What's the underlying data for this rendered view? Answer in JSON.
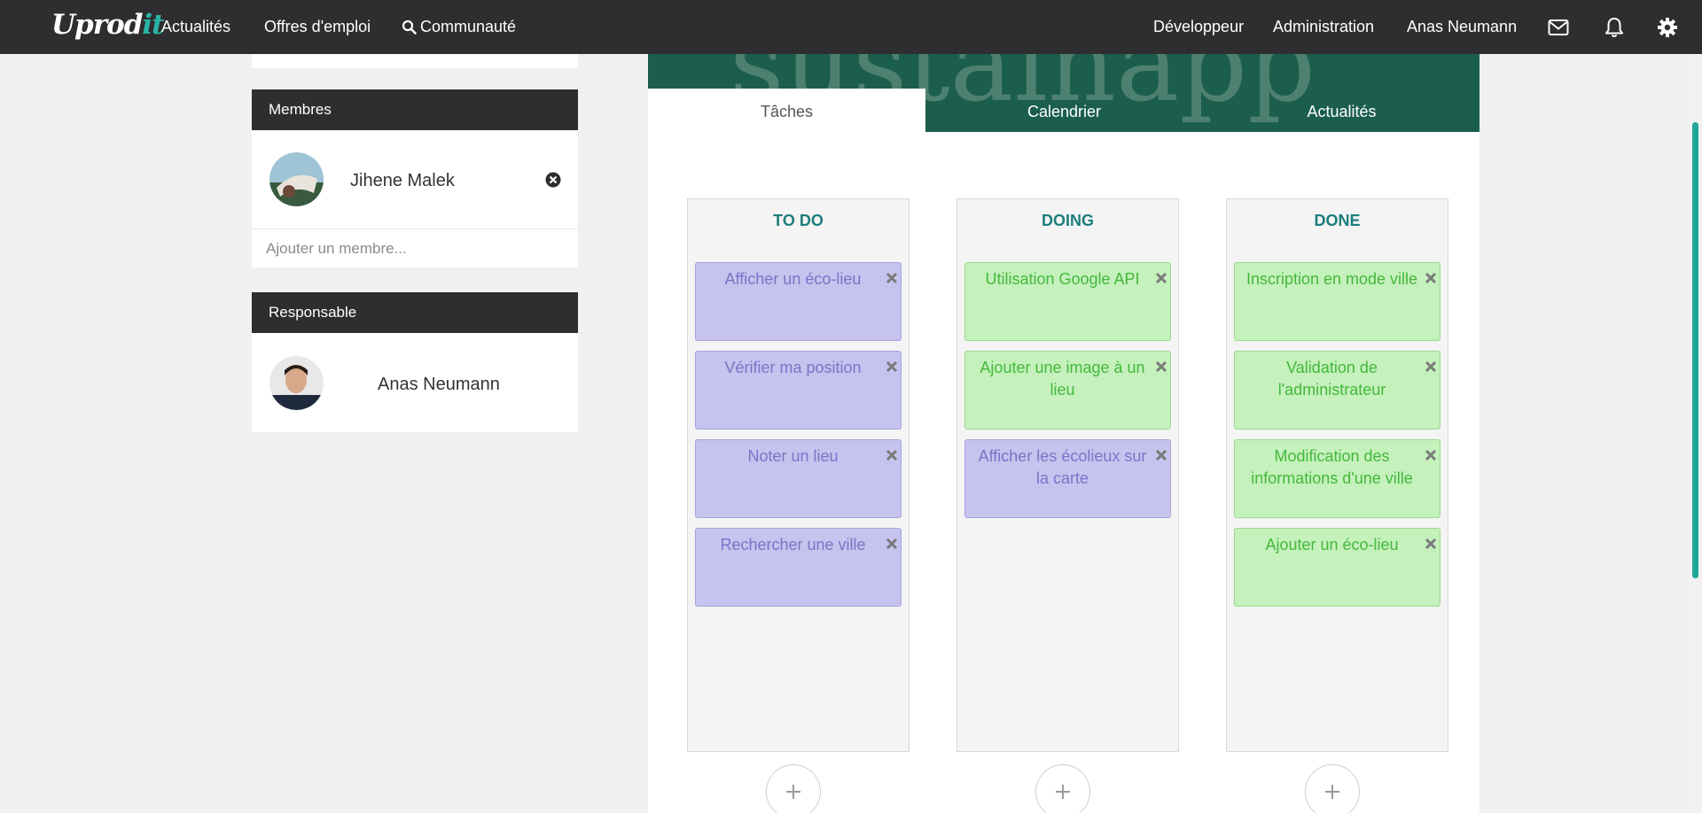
{
  "brand": {
    "name_a": "Uprod",
    "name_b": "it"
  },
  "nav": {
    "left": [
      "Actualités",
      "Offres d'emploi",
      "Communauté"
    ],
    "right": [
      "Développeur",
      "Administration",
      "Anas Neumann"
    ]
  },
  "members": {
    "title": "Membres",
    "items": [
      {
        "name": "Jihene Malek"
      }
    ],
    "add_placeholder": "Ajouter un membre..."
  },
  "responsible": {
    "title": "Responsable",
    "name": "Anas Neumann"
  },
  "project": {
    "banner_text": "sustainapp"
  },
  "tabs": [
    "Tâches",
    "Calendrier",
    "Actualités"
  ],
  "board": {
    "columns": [
      {
        "title": "TO DO",
        "tasks": [
          "Afficher un éco-lieu",
          "Vérifier ma position",
          "Noter un lieu",
          "Rechercher une ville"
        ]
      },
      {
        "title": "DOING",
        "tasks": [
          "Utilisation Google API",
          "Ajouter une image à un lieu",
          "Afficher les écolieux sur la carte"
        ]
      },
      {
        "title": "DONE",
        "tasks": [
          "Inscription en mode ville",
          "Validation de l'administrateur",
          "Modification des informations d'une ville",
          "Ajouter un éco-lieu"
        ]
      }
    ]
  },
  "colors": {
    "accent": "#21a596",
    "nav_bg": "#2e2e30",
    "banner_bg": "#1b5e4d",
    "task_purple": "#c6c3ee",
    "task_green": "#c4f1bc"
  },
  "icons": [
    "search-icon",
    "envelope-icon",
    "bell-icon",
    "gear-icon",
    "remove-member-icon",
    "close-task-icon",
    "plus-icon"
  ]
}
